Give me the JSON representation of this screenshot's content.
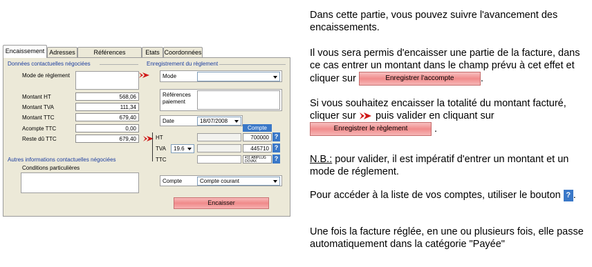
{
  "dialog": {
    "tabs": [
      "Encaissement",
      "Adresses",
      "Références commande",
      "Etats",
      "Coordonnées"
    ],
    "left": {
      "section_title": "Données contactuelles négociées",
      "mode_label": "Mode de règlement",
      "rows": [
        {
          "label": "Montant HT",
          "value": "568,06"
        },
        {
          "label": "Montant TVA",
          "value": "111,34"
        },
        {
          "label": "Montant TTC",
          "value": "679,40"
        },
        {
          "label": "Acompte TTC",
          "value": "0,00"
        },
        {
          "label": "Reste dû TTC",
          "value": "679,40"
        }
      ],
      "other_section_title": "Autres informations contactuelles négociées",
      "conditions_label": "Conditions particulières"
    },
    "right": {
      "section_title": "Enregistrement du règlement",
      "mode_label": "Mode",
      "references_label": "Références paiement",
      "date_label": "Date",
      "date_value": "18/07/2008",
      "compte_header": "Compte",
      "ht_label": "HT",
      "ht_account": "700000",
      "tva_label": "TVA",
      "tva_rate": "19.6",
      "tva_account": "445710",
      "ttc_label": "TTC",
      "ttc_account": "411 ABIPLUG DOVAX",
      "compte_label": "Compte",
      "compte_value": "Compte courant",
      "encaisser_label": "Encaisser",
      "help_glyph": "?"
    }
  },
  "help": {
    "p1": "Dans cette partie, vous pouvez suivre l'avancement des encaissements.",
    "p2_text": "Il vous sera permis d'encaisser une partie de la facture, dans ce cas entrer un montant dans le champ prévu à cet effet et cliquer sur",
    "p2_button": "Enregistrer l'accompte",
    "p2_end": ".",
    "p3_a": "Si vous souhaitez encaisser la totalité du montant facturé, cliquer sur",
    "p3_b": "puis valider en cliquant sur",
    "p3_button": "Enregistrer le règlement",
    "p3_end": ".",
    "nb_label": "N.B.:",
    "nb_text": "pour valider, il est impératif d'entrer un montant et un mode de réglement.",
    "p5_text": "Pour accéder à la liste de vos comptes, utiliser le bouton",
    "p5_glyph": "?",
    "p5_end": ".",
    "p6": "Une fois la facture réglée, en une ou plusieurs fois, elle passe automatiquement dans la catégorie \"Payée\""
  },
  "colors": {
    "panel_bg": "#ece9d8",
    "section_blue": "#1c3ea0",
    "help_button_blue": "#3a78c8",
    "pink_button": "#f08a8a",
    "arrow_red": "#d01818"
  },
  "icons": [
    "red-arrow-icon",
    "help-question-icon",
    "dropdown-arrow-icon"
  ]
}
